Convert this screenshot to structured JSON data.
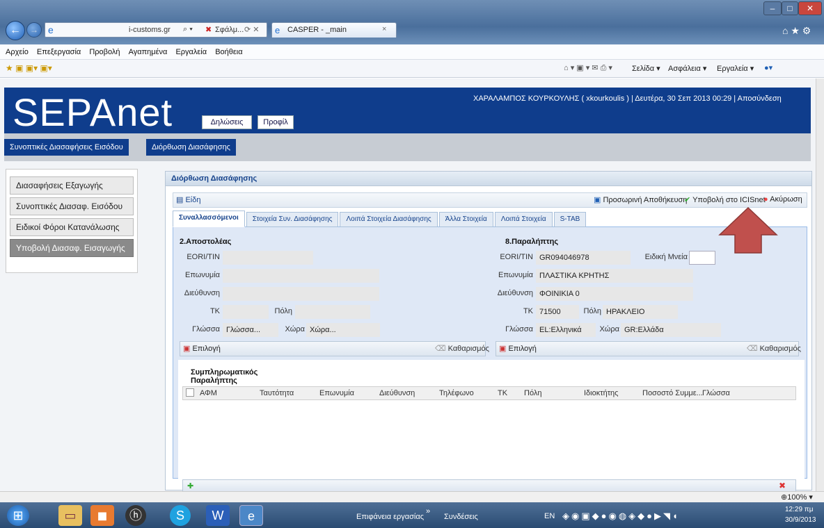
{
  "browser": {
    "address": "i-customs.gr",
    "address_search": "Σφάλμ...",
    "tab_title": "CASPER - _main",
    "menu": [
      "Αρχείο",
      "Επεξεργασία",
      "Προβολή",
      "Αγαπημένα",
      "Εργαλεία",
      "Βοήθεια"
    ],
    "cmd": [
      "Σελίδα ▾",
      "Ασφάλεια ▾",
      "Εργαλεία ▾"
    ],
    "zoom": "100%"
  },
  "app": {
    "logo": "SEPAnet",
    "nav": [
      "Δηλώσεις",
      "Προφίλ"
    ],
    "user_line": "ΧΑΡΑΛΑΜΠΟΣ ΚΟΥΡΚΟΥΛΗΣ ( xkourkoulis ) | Δευτέρα, 30 Σεπ 2013 00:29 | Αποσύνδεση",
    "breadcrumb": [
      "Συνοπτικές Διασαφήσεις Εισόδου",
      "Διόρθωση Διασάφησης"
    ]
  },
  "sidebar": [
    "Διασαφήσεις Εξαγωγής",
    "Συνοπτικές Διασαφ. Εισόδου",
    "Ειδικοί Φόροι Κατανάλωσης",
    "Υποβολή Διασαφ. Εισαγωγής"
  ],
  "panel": {
    "title": "Διόρθωση Διασάφησης",
    "items_label": "Είδη",
    "save_temp": "Προσωρινή Αποθήκευση",
    "submit": "Υποβολή στο ICISnet",
    "cancel": "Ακύρωση",
    "tabs": [
      "Συναλλασσόμενοι",
      "Στοιχεία Συν. Διασάφησης",
      "Λοιπά Στοιχεία Διασάφησης",
      "Άλλα Στοιχεία",
      "Λοιπά Στοιχεία",
      "S-TAB"
    ]
  },
  "consignor": {
    "title": "2.Αποστολέας",
    "eori_label": "EORI/TIN",
    "eori": "",
    "name_label": "Επωνυμία",
    "name": "",
    "address_label": "Διεύθυνση",
    "address": "",
    "zip_label": "ΤΚ",
    "zip": "",
    "city_label": "Πόλη",
    "city": "",
    "lang_label": "Γλώσσα",
    "lang": "Γλώσσα...",
    "country_label": "Χώρα",
    "country": "Χώρα...",
    "select": "Επιλογή",
    "clear": "Καθαρισμός"
  },
  "consignee": {
    "title": "8.Παραλήπτης",
    "eori_label": "EORI/TIN",
    "eori": "GR094046978",
    "special_label": "Ειδική Μνεία",
    "special": "",
    "name_label": "Επωνυμία",
    "name": "ΠΛΑΣΤΙΚΑ ΚΡΗΤΗΣ",
    "address_label": "Διεύθυνση",
    "address": "ΦΟΙΝΙΚΙΑ 0",
    "zip_label": "ΤΚ",
    "zip": "71500",
    "city_label": "Πόλη",
    "city": "ΗΡΑΚΛΕΙΟ",
    "lang_label": "Γλώσσα",
    "lang": "EL:Ελληνικά",
    "country_label": "Χώρα",
    "country": "GR:Ελλάδα",
    "select": "Επιλογή",
    "clear": "Καθαρισμός"
  },
  "extra": {
    "title": "Συμπληρωματικός Παραλήπτης",
    "columns": [
      "ΑΦΜ",
      "Ταυτότητα",
      "Επωνυμία",
      "Διεύθυνση",
      "Τηλέφωνο",
      "ΤΚ",
      "Πόλη",
      "Ιδιοκτήτης",
      "Ποσοστό Συμμε...",
      "Γλώσσα"
    ]
  },
  "taskbar": {
    "desktop": "Επιφάνεια εργασίας",
    "links": "Συνδέσεις",
    "lang": "EN",
    "time": "12:29 πμ",
    "date": "30/9/2013"
  },
  "colors": {
    "brand": "#0f3d8c",
    "arrow": "#c0504d"
  }
}
